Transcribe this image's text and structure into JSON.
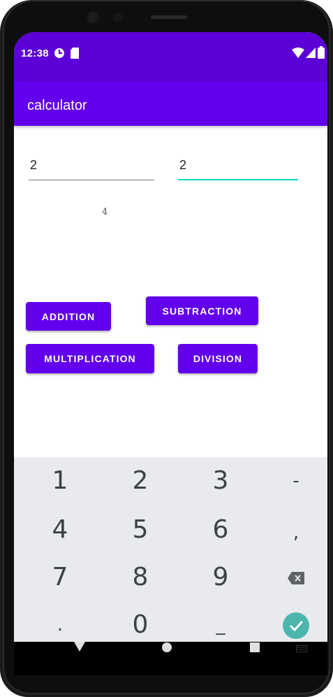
{
  "status_bar": {
    "time": "12:38",
    "icons": [
      "sync-icon",
      "sd-card-icon",
      "wifi-icon",
      "signal-icon",
      "battery-icon"
    ]
  },
  "app_bar": {
    "title": "calculator"
  },
  "inputs": {
    "first_value": "2",
    "second_value": "2"
  },
  "result_text": "4",
  "buttons": {
    "addition": "ADDITION",
    "subtraction": "SUBTRACTION",
    "multiplication": "MULTIPLICATION",
    "division": "DIVISION"
  },
  "keyboard": {
    "row1": [
      "1",
      "2",
      "3",
      "-"
    ],
    "row2": [
      "4",
      "5",
      "6",
      ","
    ],
    "row3": [
      "7",
      "8",
      "9"
    ],
    "row4": [
      ".",
      "0",
      "_"
    ]
  },
  "colors": {
    "status_bar": "#5b00d6",
    "app_bar": "#6200ee",
    "button": "#6200ee",
    "focus_underline": "#03dac5",
    "keyboard_bg": "#e8eaed",
    "enter_key": "#4db6ac"
  }
}
